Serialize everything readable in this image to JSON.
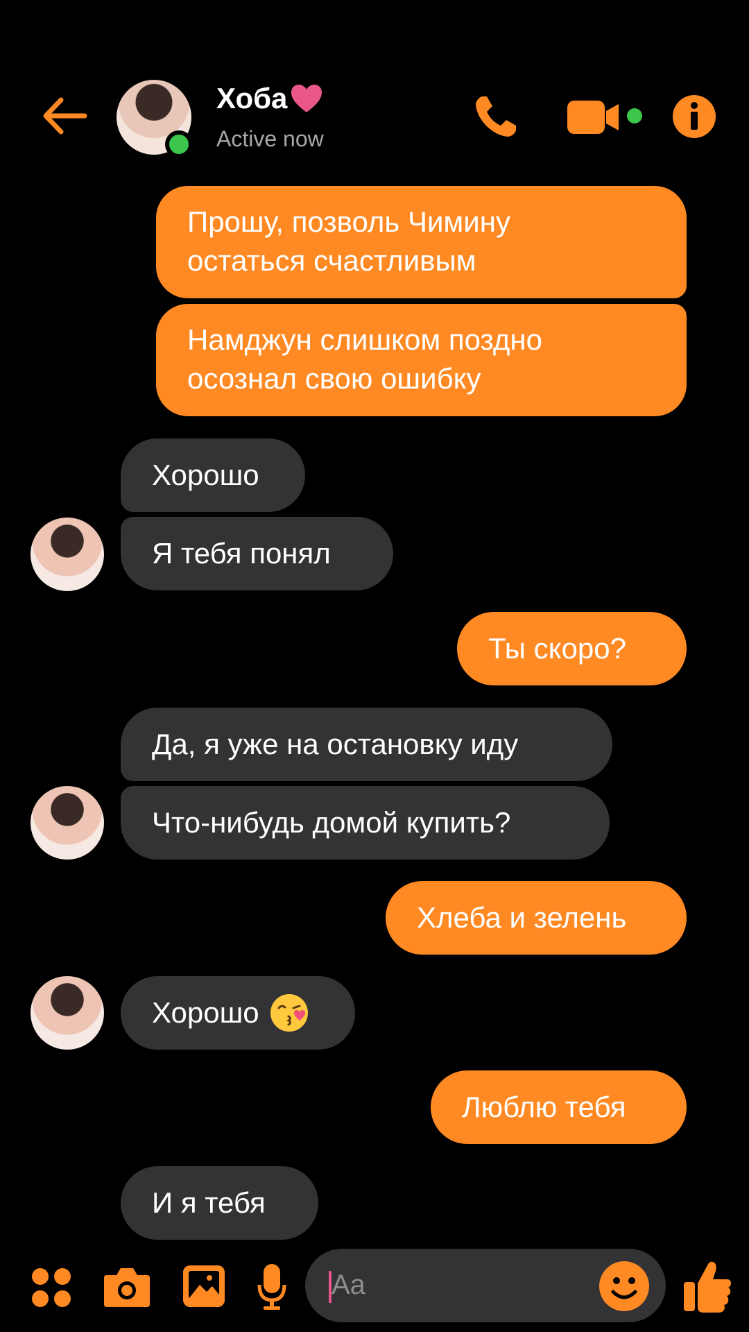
{
  "header": {
    "contact_name": "Хоба",
    "status": "Active now"
  },
  "messages": [
    {
      "side": "out",
      "text_lines": [
        "Прошу, позволь Чимину",
        "остаться счастливым"
      ]
    },
    {
      "side": "out",
      "text_lines": [
        "Намджун слишком поздно",
        "осознал свою ошибку"
      ]
    },
    {
      "side": "in",
      "text": "Хорошо"
    },
    {
      "side": "in",
      "text": "Я тебя понял"
    },
    {
      "side": "out",
      "text": "Ты скоро?"
    },
    {
      "side": "in",
      "text": "Да, я уже на остановку иду"
    },
    {
      "side": "in",
      "text": "Что-нибудь домой купить?"
    },
    {
      "side": "out",
      "text": "Хлеба и зелень"
    },
    {
      "side": "in",
      "text": "Хорошо",
      "emoji": "kissing-face-with-heart-emoji"
    },
    {
      "side": "out",
      "text": "Люблю тебя"
    },
    {
      "side": "in",
      "text": "И я тебя"
    }
  ],
  "composer": {
    "placeholder": "Aa"
  },
  "colors": {
    "accent": "#ff8a24",
    "incoming_bubble": "#333235",
    "background": "#000000",
    "online": "#3cc64b",
    "heart": "#e8568a"
  },
  "icons": [
    "back-arrow-icon",
    "phone-icon",
    "video-camera-icon",
    "info-icon",
    "menu-grid-icon",
    "camera-icon",
    "image-icon",
    "microphone-icon",
    "emoji-icon",
    "thumbs-up-icon"
  ]
}
